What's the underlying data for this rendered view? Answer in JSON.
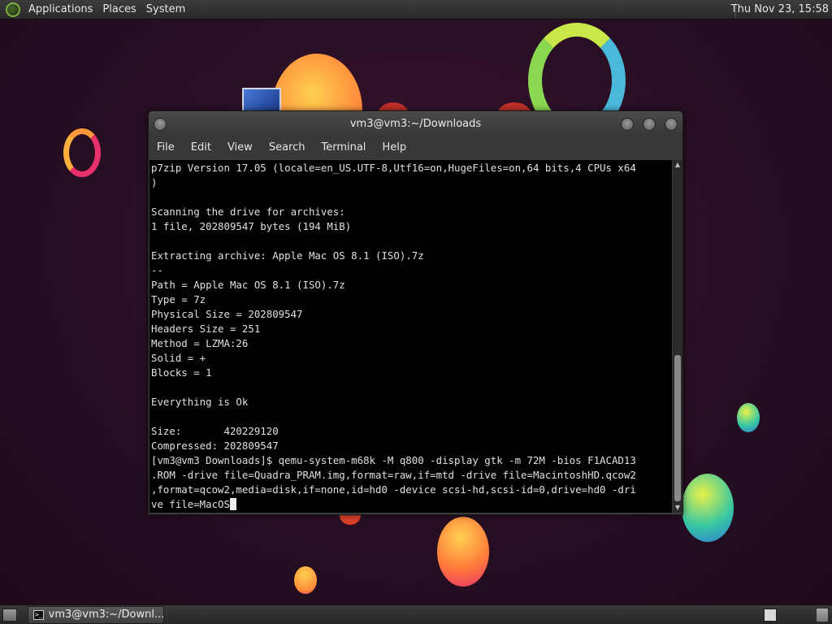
{
  "top_panel": {
    "menus": [
      "Applications",
      "Places",
      "System"
    ],
    "clock": "Thu Nov 23, 15:58"
  },
  "window": {
    "title": "vm3@vm3:~/Downloads",
    "menus": [
      "File",
      "Edit",
      "View",
      "Search",
      "Terminal",
      "Help"
    ]
  },
  "terminal": {
    "lines": [
      "p7zip Version 17.05 (locale=en_US.UTF-8,Utf16=on,HugeFiles=on,64 bits,4 CPUs x64",
      ")",
      "",
      "Scanning the drive for archives:",
      "1 file, 202809547 bytes (194 MiB)",
      "",
      "Extracting archive: Apple Mac OS 8.1 (ISO).7z",
      "--",
      "Path = Apple Mac OS 8.1 (ISO).7z",
      "Type = 7z",
      "Physical Size = 202809547",
      "Headers Size = 251",
      "Method = LZMA:26",
      "Solid = +",
      "Blocks = 1",
      "",
      "Everything is Ok",
      "",
      "Size:       420229120",
      "Compressed: 202809547",
      "[vm3@vm3 Downloads]$ qemu-system-m68k -M q800 -display gtk -m 72M -bios F1ACAD13",
      ".ROM -drive file=Quadra_PRAM.img,format=raw,if=mtd -drive file=MacintoshHD.qcow2",
      ",format=qcow2,media=disk,if=none,id=hd0 -device scsi-hd,scsi-id=0,drive=hd0 -dri",
      "ve file=MacOS"
    ]
  },
  "bottom_panel": {
    "task_label": "vm3@vm3:~/Downl..."
  },
  "colors": {
    "terminal_bg": "#000000",
    "terminal_fg": "#e0e0e0",
    "panel_bg": "#2e2e2e",
    "wallpaper_bg": "#2a0f25"
  },
  "icons": {
    "menu_logo": "gnome-foot-icon",
    "terminal": "terminal-icon",
    "workspace": "workspace-switcher-icon",
    "trash": "trash-icon",
    "show_desktop": "show-desktop-icon"
  }
}
